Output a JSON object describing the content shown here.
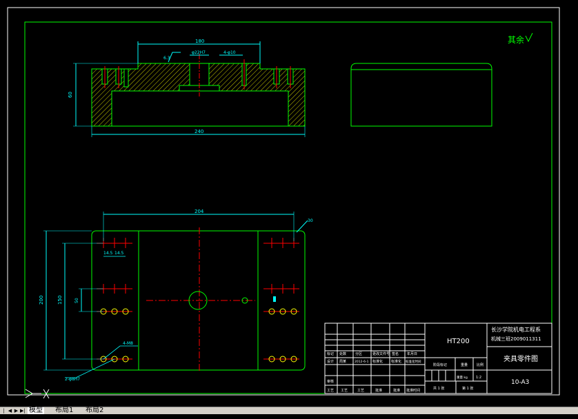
{
  "drawing": {
    "surface_note": "其余",
    "top_view": {
      "dim_top_width": "180",
      "dim_center_hole": "φ22H7",
      "dim_right_hole": "4-φ10",
      "dim_roughness": "6.3",
      "dim_height": "60",
      "dim_bottom_width": "240"
    },
    "bottom_view": {
      "dim_width": "204",
      "dim_height_outer": "200",
      "dim_height_inner": "150",
      "dim_vertical_small": "50",
      "dim_hole_a": "14.5",
      "dim_hole_b": "14.5",
      "note_right": "30",
      "label_holes": "4-M8",
      "label_pins": "2-φ8H7"
    }
  },
  "title_block": {
    "material": "HT200",
    "school": "长沙学院机电工程系",
    "class_name": "机械三班2009011311",
    "drawing_title": "夹具零件图",
    "drawing_no": "10-A3",
    "row_labels": [
      "标记",
      "处数",
      "分区",
      "更改文件号",
      "签名",
      "年月日"
    ],
    "design_row": [
      "设计",
      "周某",
      "2012-6-1",
      "标准化",
      "标准化",
      "标准化时间"
    ],
    "review": "审核",
    "process_row": [
      "工艺",
      "工艺",
      "工艺",
      "批准",
      "批准",
      "批准时间"
    ],
    "stage_label": "阶段标记",
    "weight_label": "重量",
    "scale_label": "比例",
    "weight_unit": "重量 kg",
    "scale_value": "1:2",
    "sheets_left": "共 1 张",
    "sheets_right": "第 1 张"
  },
  "tabs": {
    "model": "模型",
    "layout1": "布局1",
    "layout2": "布局2"
  },
  "colors": {
    "background": "#000000",
    "border": "#00ff00",
    "outline": "#00ff00",
    "dimension": "#00ffff",
    "centerline": "#ff0000",
    "hatch": "#ffff00",
    "white": "#ffffff"
  }
}
